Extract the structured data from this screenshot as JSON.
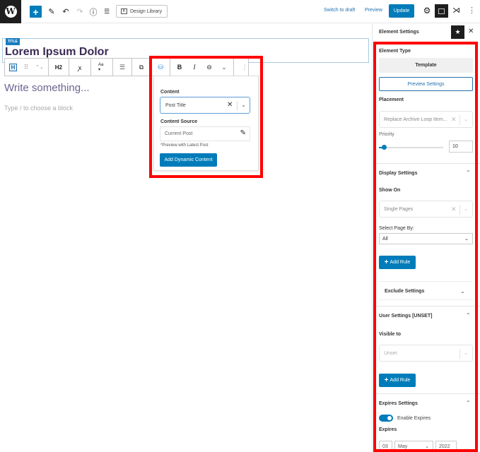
{
  "topbar": {
    "logo_icon": "wordpress-logo",
    "add_block_label": "+",
    "tools": [
      {
        "name": "edit-pencil-icon",
        "glyph": "✎"
      },
      {
        "name": "undo-icon",
        "glyph": "↶"
      },
      {
        "name": "redo-icon",
        "glyph": "↷"
      },
      {
        "name": "info-icon",
        "glyph": "ⓘ"
      },
      {
        "name": "list-view-icon",
        "glyph": "☰"
      }
    ],
    "design_library_label": "Design Library",
    "design_library_icon": "K",
    "switch_to_draft": "Switch to draft",
    "preview": "Preview",
    "update": "Update",
    "settings_glyph": "⚙",
    "kadence_glyph": "⋊",
    "more_glyph": "⋮"
  },
  "editor": {
    "title_badge": "TITLE",
    "title_text": "Lorem Ipsum Dolor",
    "toolbar": {
      "h_label": "H",
      "drag_glyph": "⠿",
      "move_glyph": "⌃⌄",
      "heading_level": "H2",
      "typography_glyph": "ꭗ",
      "font_size_label": "Aa ▾",
      "align_glyph": "☰",
      "copy_glyph": "⧉",
      "dynamic_glyph": "⛁",
      "bold": "B",
      "italic": "I",
      "link_glyph": "⊖",
      "more_rich_glyph": "⌄",
      "options_glyph": "⋮"
    },
    "paragraph_placeholder": "Write something...",
    "block_hint": "Type / to choose a block"
  },
  "dynamic_popover": {
    "content_label": "Content",
    "content_value": "Post Title",
    "content_source_label": "Content Source",
    "content_source_value": "Current Post",
    "preview_note": "*Preview with Latest Post",
    "add_button": "Add Dynamic Content"
  },
  "sidebar": {
    "title": "Element Settings",
    "element_type_label": "Element Type",
    "element_type_value": "Template",
    "preview_settings": "Preview Settings",
    "placement_label": "Placement",
    "placement_value": "Replace Archive Loop Item...",
    "priority_label": "Priority",
    "priority_value": "10",
    "priority_fraction": 0.05,
    "display_settings": {
      "title": "Display Settings",
      "show_on_label": "Show On",
      "show_on_value": "Single Pages",
      "select_page_by_label": "Select Page By:",
      "select_page_by_value": "All",
      "add_rule": "Add Rule",
      "exclude_settings": "Exclude Settings"
    },
    "user_settings": {
      "title": "User Settings [UNSET]",
      "visible_to_label": "Visible to",
      "visible_to_value": "Unset",
      "add_rule": "Add Rule"
    },
    "expires_settings": {
      "title": "Expires Settings",
      "enable_label": "Enable Expires",
      "enabled": true,
      "expires_label": "Expires",
      "day": "03",
      "month": "May",
      "year": "2022"
    }
  },
  "colors": {
    "accent": "#007cba",
    "highlight": "#ff0000",
    "title_text": "#3a2a55",
    "placeholder": "#6d6391"
  }
}
